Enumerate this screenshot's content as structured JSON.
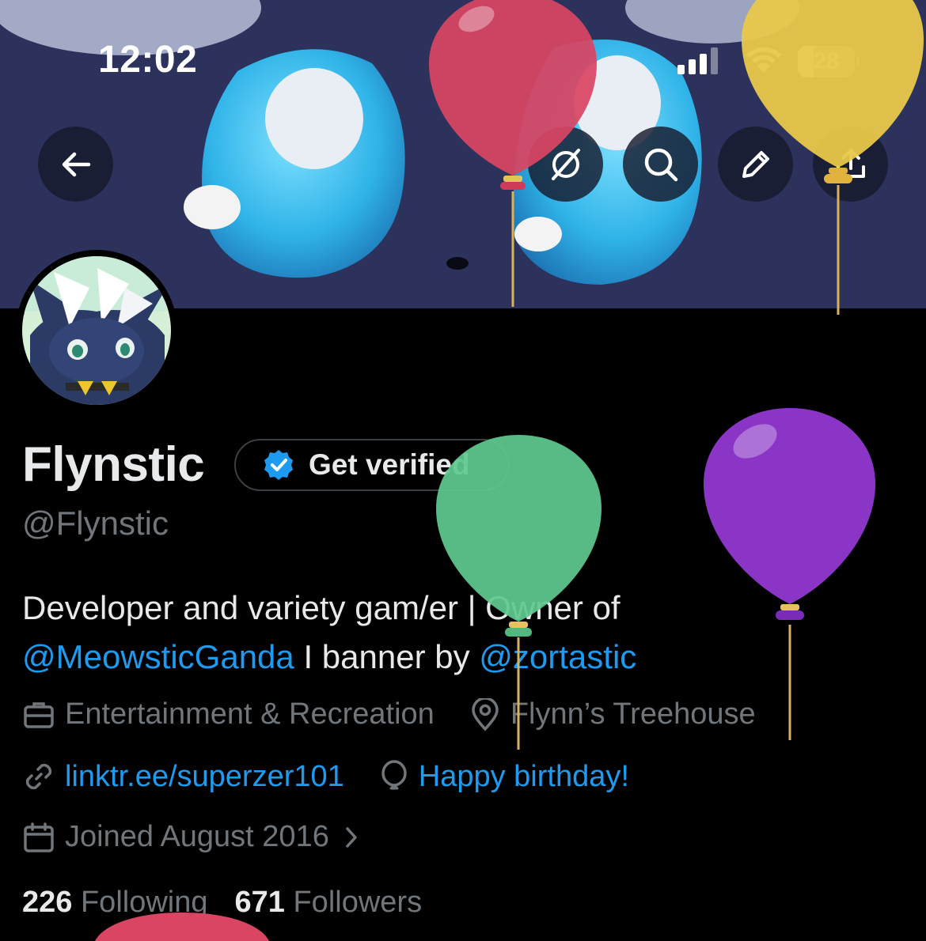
{
  "status_bar": {
    "time": "12:02",
    "battery": "28",
    "battery_level": 0.28
  },
  "nav": {
    "back": "back-arrow-icon",
    "grok": "grok-icon",
    "search": "search-icon",
    "edit": "pencil-icon",
    "share": "share-icon"
  },
  "profile": {
    "name": "Flynstic",
    "verify_label": "Get verified",
    "handle": "@Flynstic",
    "bio": {
      "line1": "Developer and variety gam/er | Owner of",
      "mention1": "@MeowsticGanda",
      "middle": " I banner by ",
      "mention2": "@zortastic"
    },
    "category": "Entertainment & Recreation",
    "location": "Flynn’s Treehouse",
    "website": "linktr.ee/superzer101",
    "birthday": "Happy birthday!",
    "joined": "Joined August 2016",
    "following_count": "226",
    "following_label": "Following",
    "followers_count": "671",
    "followers_label": "Followers"
  },
  "colors": {
    "background": "#000000",
    "text_primary": "#e7e9ea",
    "text_secondary": "#71767b",
    "link": "#1d9bf0",
    "balloon_red": "#d94563",
    "balloon_yellow": "#e8c84a",
    "balloon_green": "#5fc990",
    "balloon_purple": "#8a35c6"
  }
}
